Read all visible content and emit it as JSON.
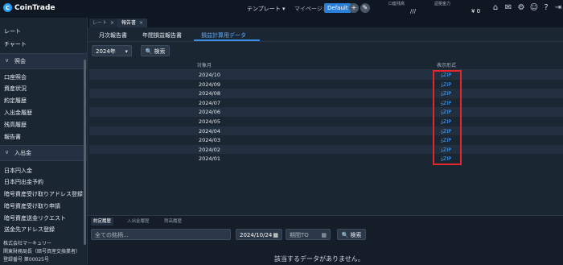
{
  "app": {
    "name": "CoinTrade",
    "logo_letter": "C"
  },
  "topbar": {
    "template_label": "テンプレート ▾",
    "mypage_label": "マイページ:",
    "default_label": "Default",
    "plus_icon": "+",
    "edit_icon": "✎",
    "account_label": "口座残高",
    "account_value": "///",
    "margin_label": "証拠金力",
    "margin_value": "¥ 0",
    "icons": [
      "home-icon",
      "mail-icon",
      "gear-icon",
      "user-icon",
      "help-icon",
      "logout-icon"
    ]
  },
  "sidebar": {
    "top_items": [
      "レート",
      "チャート"
    ],
    "sections": [
      {
        "label": "照会",
        "items": [
          "口座照会",
          "資産状況",
          "約定履歴",
          "入出金履歴",
          "残高履歴",
          "報告書"
        ]
      },
      {
        "label": "入出金",
        "items": [
          "日本円入金",
          "日本円出金予約",
          "暗号資産受け取りアドレス登録",
          "暗号資産受け取り申請",
          "暗号資産送金リクエスト",
          "送金先アドレス登録"
        ]
      }
    ],
    "footer": [
      "株式会社マーキュリー",
      "関東財務局長（暗号資産交換業者）",
      "登録番号 第00025号"
    ]
  },
  "doc_tabs": [
    {
      "label": "レート",
      "active": false
    },
    {
      "label": "報告書",
      "active": true
    }
  ],
  "subtabs": [
    {
      "label": "月次報告書",
      "active": false
    },
    {
      "label": "年間損益報告書",
      "active": false
    },
    {
      "label": "損益計算用データ",
      "active": true
    }
  ],
  "filter": {
    "year": "2024年",
    "search_label": "🔍 検索"
  },
  "table": {
    "headers": {
      "month": "対象月",
      "format": "表示形式"
    },
    "rows": [
      {
        "month": "2024/10",
        "format": "⤓ZIP"
      },
      {
        "month": "2024/09",
        "format": "⤓ZIP"
      },
      {
        "month": "2024/08",
        "format": "⤓ZIP"
      },
      {
        "month": "2024/07",
        "format": "⤓ZIP"
      },
      {
        "month": "2024/06",
        "format": "⤓ZIP"
      },
      {
        "month": "2024/05",
        "format": "⤓ZIP"
      },
      {
        "month": "2024/04",
        "format": "⤓ZIP"
      },
      {
        "month": "2024/03",
        "format": "⤓ZIP"
      },
      {
        "month": "2024/02",
        "format": "⤓ZIP"
      },
      {
        "month": "2024/01",
        "format": "⤓ZIP"
      }
    ]
  },
  "bottom": {
    "tabs": [
      {
        "label": "約定履歴",
        "active": true
      },
      {
        "label": "入出金履歴",
        "active": false
      },
      {
        "label": "残高履歴",
        "active": false
      }
    ],
    "brand_placeholder": "全ての銘柄...",
    "date_from": "2024/10/24",
    "date_to": "期間TO",
    "calendar_icon": "▦",
    "search_label": "🔍 検索",
    "empty_message": "該当するデータがありません。"
  }
}
